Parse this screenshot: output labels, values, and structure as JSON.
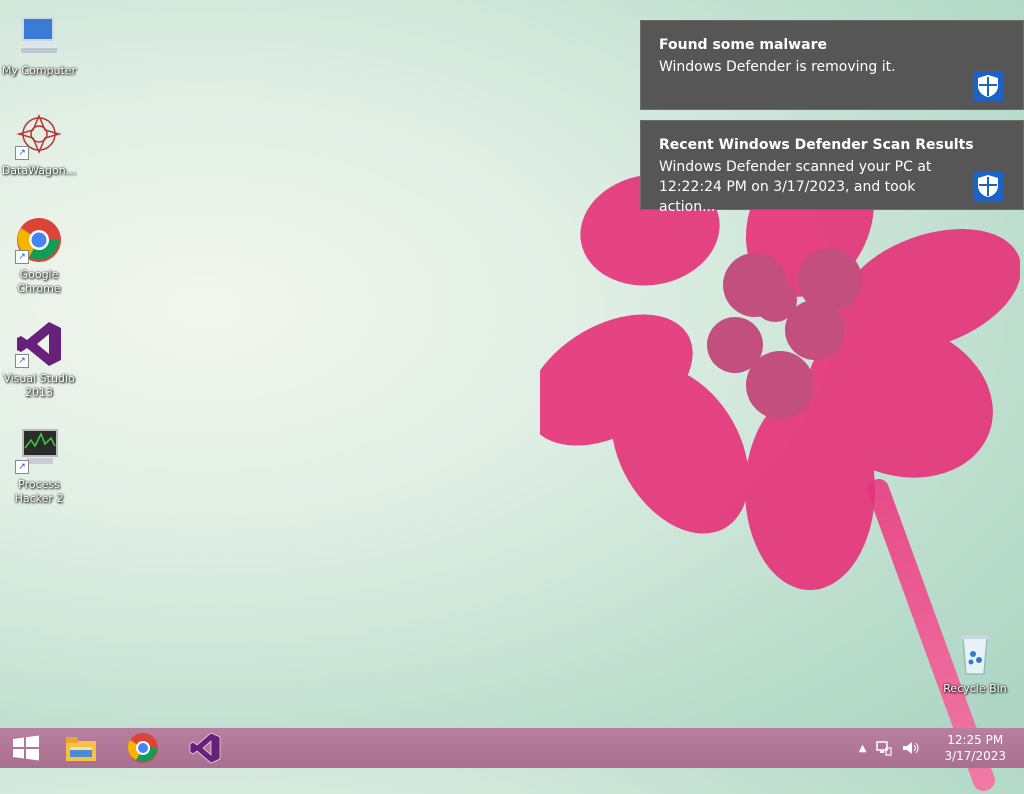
{
  "desktop_icons": [
    {
      "name": "my-computer",
      "label": "My Computer"
    },
    {
      "name": "datawagon",
      "label": "DataWagon..."
    },
    {
      "name": "google-chrome",
      "label": "Google Chrome"
    },
    {
      "name": "visual-studio",
      "label": "Visual Studio 2013"
    },
    {
      "name": "process-hacker",
      "label": "Process Hacker 2"
    }
  ],
  "recycle_bin": {
    "label": "Recycle Bin"
  },
  "notifications": [
    {
      "title": "Found some malware",
      "body": "Windows Defender is removing it.",
      "icon": "shield-icon"
    },
    {
      "title": "Recent Windows Defender Scan Results",
      "body": "Windows Defender scanned your PC at 12:22:24 PM on 3/17/2023, and took action...",
      "icon": "shield-icon"
    }
  ],
  "taskbar": {
    "start": "windows-logo-icon",
    "pinned": [
      "file-explorer-icon",
      "chrome-icon",
      "visual-studio-icon"
    ],
    "tray": {
      "time": "12:25 PM",
      "date": "3/17/2023"
    }
  },
  "colors": {
    "taskbar": "#b07594",
    "toast": "#565656",
    "defender_blue": "#1b63c7"
  }
}
